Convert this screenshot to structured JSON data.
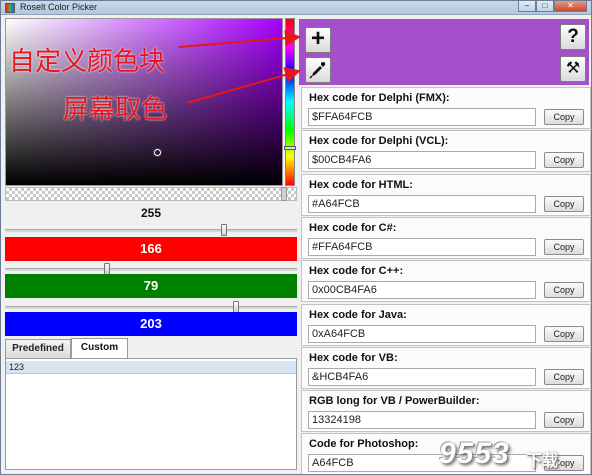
{
  "window": {
    "title": "Roselt Color Picker",
    "min_glyph": "–",
    "max_glyph": "□",
    "close_glyph": "✕"
  },
  "sliders": {
    "alpha": {
      "value": "255",
      "level": 0.75
    },
    "red": {
      "value": "166",
      "level": 0.35,
      "color": "#ff0000"
    },
    "green": {
      "value": "79",
      "level": 0.79,
      "color": "#008000"
    },
    "blue": {
      "value": "203",
      "level": 1.0,
      "color": "#0000ff"
    }
  },
  "picker": {
    "hue_color": "#a800ff"
  },
  "tabs": {
    "predefined": "Predefined",
    "custom": "Custom"
  },
  "custom_list": {
    "first_item": "123"
  },
  "toolbar": {
    "add_glyph": "+",
    "help_glyph": "?",
    "tools_glyph": "⚒"
  },
  "preview": {
    "color": "#a64fcb"
  },
  "copy_label": "Copy",
  "codes": [
    {
      "label": "Hex code for Delphi (FMX):",
      "value": "$FFA64FCB"
    },
    {
      "label": "Hex code for Delphi (VCL):",
      "value": "$00CB4FA6"
    },
    {
      "label": "Hex code for HTML:",
      "value": "#A64FCB"
    },
    {
      "label": "Hex code for C#:",
      "value": "#FFA64FCB"
    },
    {
      "label": "Hex code for C++:",
      "value": "0x00CB4FA6"
    },
    {
      "label": "Hex code for Java:",
      "value": "0xA64FCB"
    },
    {
      "label": "Hex code for VB:",
      "value": "&HCB4FA6"
    },
    {
      "label": "RGB long for VB / PowerBuilder:",
      "value": "13324198"
    },
    {
      "label": "Code for Photoshop:",
      "value": "A64FCB"
    }
  ],
  "annotations": {
    "custom_block": "自定义颜色块",
    "screen_pick": "屏幕取色"
  },
  "watermark": {
    "number": "9553",
    "sub": "下载"
  }
}
